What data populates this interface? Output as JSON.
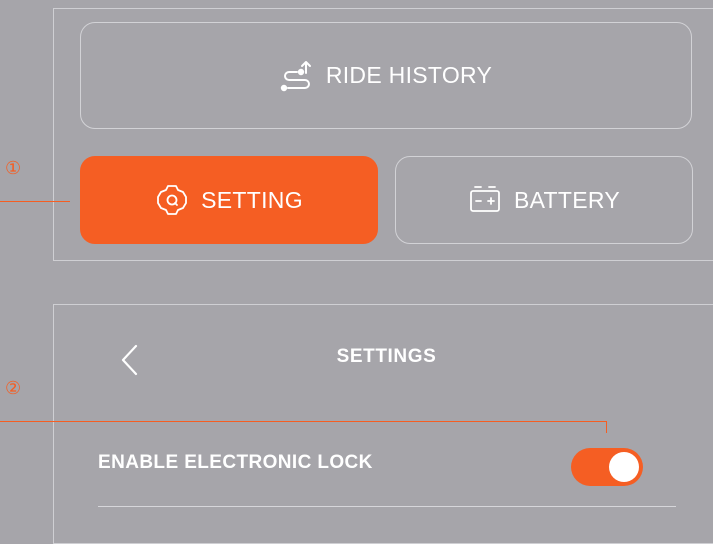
{
  "menu": {
    "ride_history_label": "RIDE HISTORY",
    "setting_label": "SETTING",
    "battery_label": "BATTERY",
    "icons": {
      "ride_history": "route-icon",
      "setting": "gear-icon",
      "battery": "battery-icon"
    }
  },
  "annotations": {
    "marker_1": "①",
    "marker_2": "②"
  },
  "settings_screen": {
    "title": "SETTINGS",
    "back_icon": "chevron-left-icon",
    "options": [
      {
        "label": "ENABLE ELECTRONIC LOCK",
        "enabled": true
      }
    ]
  },
  "colors": {
    "accent": "#f55e23",
    "background": "#a6a5aa",
    "text": "#ffffff"
  }
}
